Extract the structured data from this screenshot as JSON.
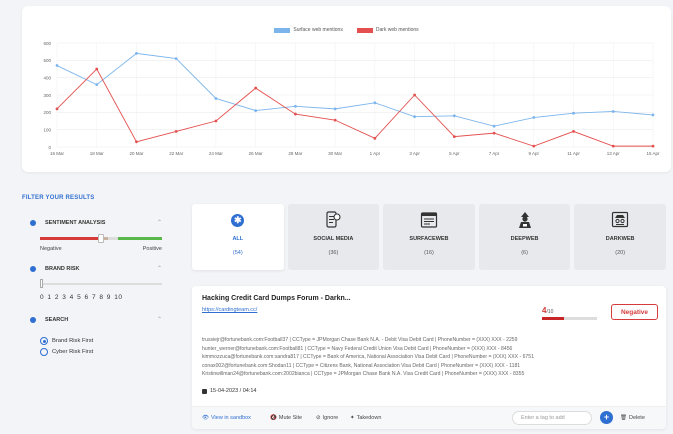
{
  "chart_data": {
    "type": "line",
    "x": [
      "16 Mar",
      "18 Mar",
      "20 Mar",
      "22 Mar",
      "24 Mar",
      "26 Mar",
      "28 Mar",
      "30 Mar",
      "1 Apr",
      "3 Apr",
      "5 Apr",
      "7 Apr",
      "9 Apr",
      "11 Apr",
      "13 Apr",
      "15 Apr"
    ],
    "series": [
      {
        "name": "Surface web mentions",
        "color": "#7cb5ec",
        "values": [
          470,
          360,
          540,
          510,
          280,
          210,
          235,
          220,
          255,
          175,
          180,
          120,
          170,
          195,
          205,
          185
        ]
      },
      {
        "name": "Dark web mentions",
        "color": "#e4504f",
        "values": [
          220,
          450,
          30,
          90,
          150,
          340,
          190,
          155,
          50,
          300,
          60,
          80,
          5,
          90,
          5,
          5
        ]
      }
    ],
    "ylim": [
      0,
      600
    ],
    "yticks": [
      "0",
      "100",
      "200",
      "300",
      "400",
      "500",
      "600"
    ],
    "grid": true,
    "legend": "top-center"
  },
  "filter": {
    "title": "FILTER YOUR RESULTS",
    "sentiment_label": "SENTIMENT ANALYSIS",
    "negative_label": "Negative",
    "positive_label": "Positive",
    "brand_risk_label": "BRAND RISK",
    "risk_numbers": "0 1 2 3 4 5 6 7 8 9 10",
    "search_label": "SEARCH",
    "radio_brand": "Brand Risk First",
    "radio_cyber": "Cyber Risk First"
  },
  "tabs": [
    {
      "name": "ALL",
      "count": "(54)",
      "icon": "asterisk-icon"
    },
    {
      "name": "SOCIAL MEDIA",
      "count": "(36)",
      "icon": "social-media-icon"
    },
    {
      "name": "SURFACEWEB",
      "count": "(16)",
      "icon": "browser-window-icon"
    },
    {
      "name": "DEEPWEB",
      "count": "(6)",
      "icon": "hacker-icon"
    },
    {
      "name": "DARKWEB",
      "count": "(20)",
      "icon": "spy-icon"
    }
  ],
  "result": {
    "title": "Hacking Credit Card Dumps Forum - Darkn...",
    "link": "https://cardingteam.cc/",
    "score": "4",
    "score_max": "/10",
    "score_fraction": 0.4,
    "sentiment_badge": "Negative",
    "lines": [
      "trussiejr@fortunebank.com:Football37 | CCType = JPMorgan Chase Bank N.A. - Debit Visa Debit Card | PhoneNumber = (XXX) XXX - 2259",
      "hunter_werner@fortunebank.com:Football81 | CCType = Navy Federal Credit Union Visa Debit Card | PhoneNumber = (XXX) XXX - 8456",
      "kimmozzuca@fortunebank.com:sandra817 | CCType = Bank of America, National Association Visa Debit Card | PhoneNumber = (XXX) XXX - 6751",
      "conax002@fortunebank.com:Shodan11 | CCType = Citizens Bank, National Association Visa Debit Card | PhoneNumber = (XXX) XXX - 1181",
      "Kristinwillman24@fortunebank.com:2002bianca | CCType = JPMorgan Chase Bank N.A. Visa Credit Card | PhoneNumber = (XXX) XXX - 8355"
    ],
    "date": "15-04-2023 / 04:14",
    "actions": {
      "view": "View in sandbox",
      "mute": "Mute Site",
      "ignore": "Ignore",
      "takedown": "Takedown",
      "tag_placeholder": "Enter a tag to add",
      "delete": "Delete"
    }
  }
}
